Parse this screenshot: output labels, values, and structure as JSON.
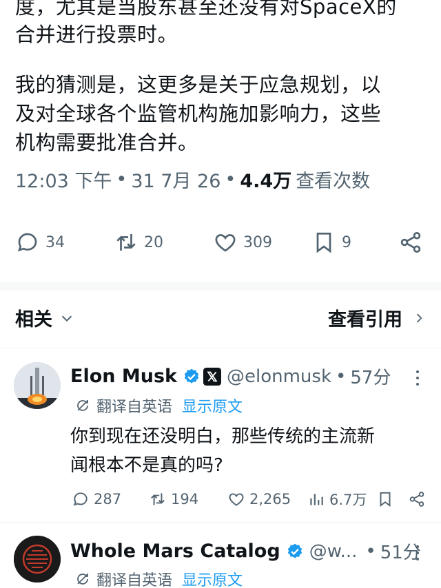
{
  "tweet": {
    "lines": [
      "度，尤其是当股东甚至还没有对SpaceX的",
      "合并进行投票时。",
      "我的猜测是，这更多是关于应急规划，以",
      "及对全球各个监管机构施加影响力，这些",
      "机构需要批准合并。"
    ],
    "time": "12:03 下午",
    "sep1": "•",
    "date": "31 7月 26",
    "sep2": "•",
    "views": "4.4万",
    "views_label": "查看次数"
  },
  "actions": {
    "replies": "34",
    "reposts": "20",
    "likes": "309",
    "bookmarks": "9"
  },
  "related": {
    "label": "相关",
    "quotes_label": "查看引用"
  },
  "replies": [
    {
      "name": "Elon Musk",
      "handle": "@elonmusk",
      "sep": "•",
      "time": "57分",
      "translated_label": "翻译自英语",
      "show_original": "显示原文",
      "text_lines": [
        "你到现在还没明白，那些传统的主流新",
        "闻根本不是真的吗?"
      ],
      "replies": "287",
      "reposts": "194",
      "likes": "2,265",
      "views": "6.7万"
    },
    {
      "name": "Whole Mars Catalog",
      "handle": "@w...",
      "sep": "•",
      "time": "51分",
      "translated_label": "翻译自英语",
      "show_original": "显示原文"
    }
  ],
  "colors": {
    "text": "#0f1419",
    "secondary": "#536471",
    "link": "#1d9bf0",
    "verified": "#1d9bf0"
  },
  "icons": [
    "reply-icon",
    "repost-icon",
    "like-icon",
    "bookmark-icon",
    "share-icon",
    "chevron-down-icon",
    "chevron-right-icon",
    "verified-badge-icon",
    "x-logo-icon",
    "translate-icon",
    "views-icon",
    "more-icon"
  ]
}
